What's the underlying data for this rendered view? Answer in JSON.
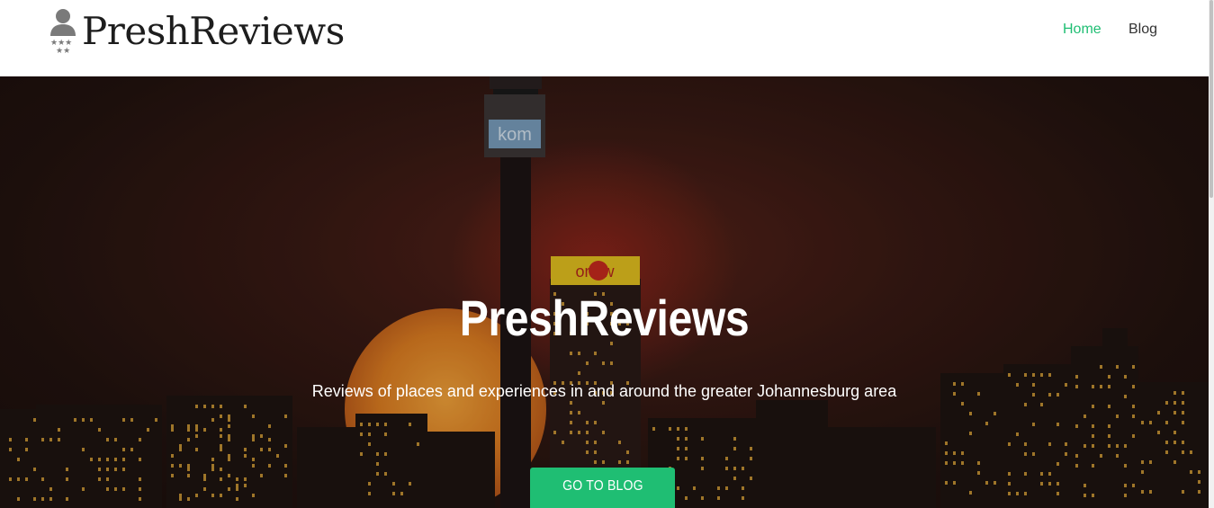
{
  "header": {
    "logo_text": "PreshReviews",
    "nav": {
      "home_label": "Home",
      "blog_label": "Blog"
    }
  },
  "hero": {
    "title": "PreshReviews",
    "subtitle": "Reviews of places and experiences in and around the greater Johannesburg area",
    "cta_label": "GO TO BLOG",
    "tower_sign_text": "kom",
    "building_sign_text": "om  w"
  },
  "colors": {
    "accent": "#1fbe73",
    "nav_text": "#333333",
    "logo_text": "#1d1d1d",
    "logo_icon": "#7a7a7a",
    "hero_text": "#ffffff"
  },
  "icons": {
    "logo_icon": "person-with-stars-icon"
  }
}
